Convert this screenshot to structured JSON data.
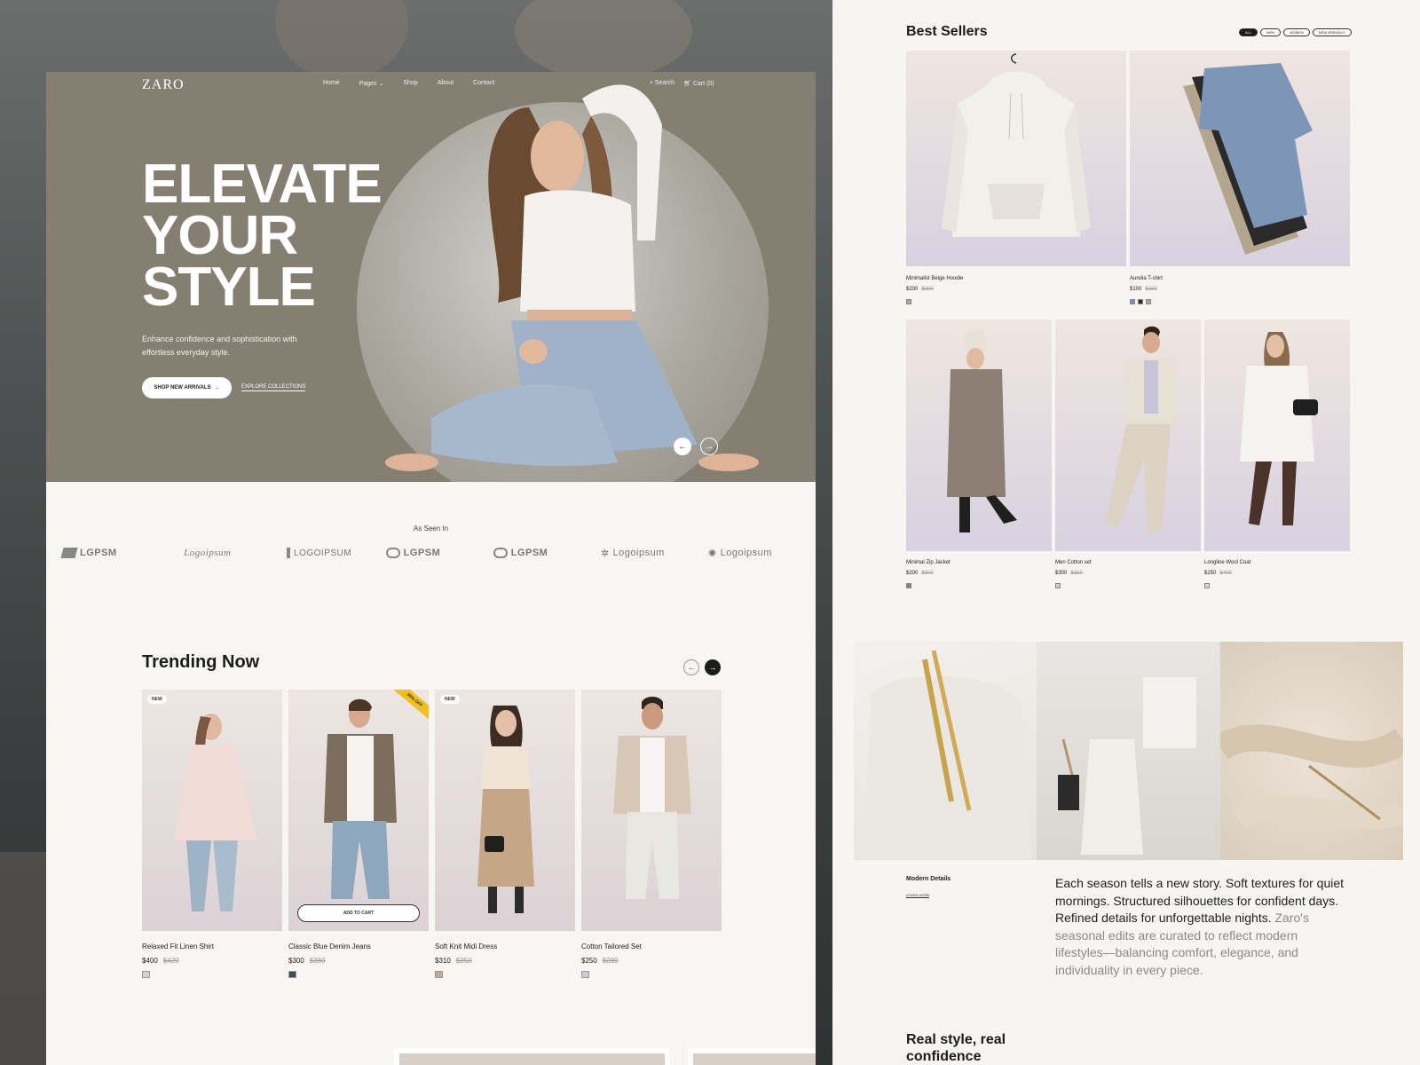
{
  "brand": {
    "logo": "ZARO"
  },
  "nav": {
    "links": [
      "Home",
      "Pages",
      "Shop",
      "About",
      "Contact"
    ],
    "search": "Search",
    "cart": "Cart (0)"
  },
  "hero": {
    "title_lines": [
      "ELEVATE",
      "YOUR",
      "STYLE"
    ],
    "subtitle": "Enhance confidence and sophistication with effortless everyday style.",
    "primary_cta": "SHOP NEW ARRIVALS",
    "secondary_cta": "EXPLORE COLLECTIONS"
  },
  "seen_in": {
    "label": "As Seen In",
    "logos": [
      "LGPSM",
      "Logoipsum",
      "LOGOIPSUM",
      "LGPSM",
      "LGPSM",
      "Logoipsum",
      "Logoipsum"
    ]
  },
  "trending": {
    "title": "Trending Now",
    "products": [
      {
        "name": "Relaxed Fit Linen Shirt",
        "price": "$400",
        "old_price": "$420",
        "badge": "NEW",
        "swatch": "#d7d2cd"
      },
      {
        "name": "Classic Blue Denim Jeans",
        "price": "$300",
        "old_price": "$360",
        "badge": "30% OFF",
        "cta": "ADD TO CART",
        "swatch": "#3f4a5a"
      },
      {
        "name": "Soft Knit Midi Dress",
        "price": "$310",
        "old_price": "$350",
        "badge": "NEW",
        "swatch": "#c7a98c"
      },
      {
        "name": "Cotton Tailored Set",
        "price": "$250",
        "old_price": "$280",
        "badge": "",
        "swatch": "#c9cfd6"
      }
    ]
  },
  "best_sellers": {
    "title": "Best Sellers",
    "filters": [
      "ALL",
      "MEN",
      "WOMEN",
      "NEW ARRIVALS"
    ],
    "products": [
      {
        "name": "Minimalist Beige Hoodie",
        "price": "$200",
        "old_price": "$300",
        "swatches": [
          "#a9a49d"
        ]
      },
      {
        "name": "Aurelia T-shirt",
        "price": "$100",
        "old_price": "$200",
        "swatches": [
          "#7b93b3",
          "#2b2b2b",
          "#b3a58e"
        ]
      },
      {
        "name": "Minimal Zip Jacket",
        "price": "$200",
        "old_price": "$300",
        "swatches": [
          "#8d7f73"
        ]
      },
      {
        "name": "Men Cotton set",
        "price": "$300",
        "old_price": "$310",
        "swatches": [
          "#cfc7bb"
        ]
      },
      {
        "name": "Longline Wool Coat",
        "price": "$250",
        "old_price": "$400",
        "swatches": [
          "#d9d6d0"
        ]
      }
    ]
  },
  "editorial": {
    "label": "Modern Details",
    "link": "LEARN MORE",
    "story_strong": "Each season tells a new story. Soft textures for quiet mornings. Structured silhouettes for confident days. Refined details for unforgettable nights.",
    "story_muted": "Zaro's seasonal edits are curated to reflect modern lifestyles—balancing comfort, elegance, and individuality in every piece."
  },
  "real_style": {
    "title": "Real style, real confidence"
  },
  "colors": {
    "hero_bg": "#857f71",
    "accent_badge": "#f0c020",
    "dark": "#1c1c1c",
    "page_bg": "#f8f6f3"
  }
}
